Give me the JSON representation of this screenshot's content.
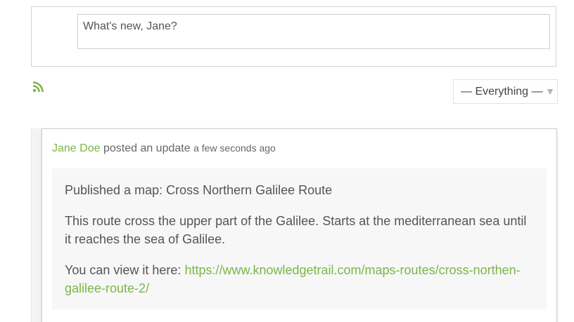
{
  "composer": {
    "placeholder": "What's new, Jane?"
  },
  "feed": {
    "rss_icon": "rss-icon",
    "accent_color": "#7ab648"
  },
  "filter": {
    "selected": "— Everything —",
    "arrow": "▼"
  },
  "activity": {
    "author": "Jane Doe",
    "action": "posted an update",
    "time": "a few seconds ago",
    "title_line": "Published a map: Cross Northern Galilee Route",
    "description": "This route cross the upper part of the Galilee. Starts at the mediterranean sea until it reaches the sea of Galilee.",
    "view_prefix": "You can view it here: ",
    "link": "https://www.knowledgetrail.com/maps-routes/cross-northen-galilee-route-2/"
  }
}
